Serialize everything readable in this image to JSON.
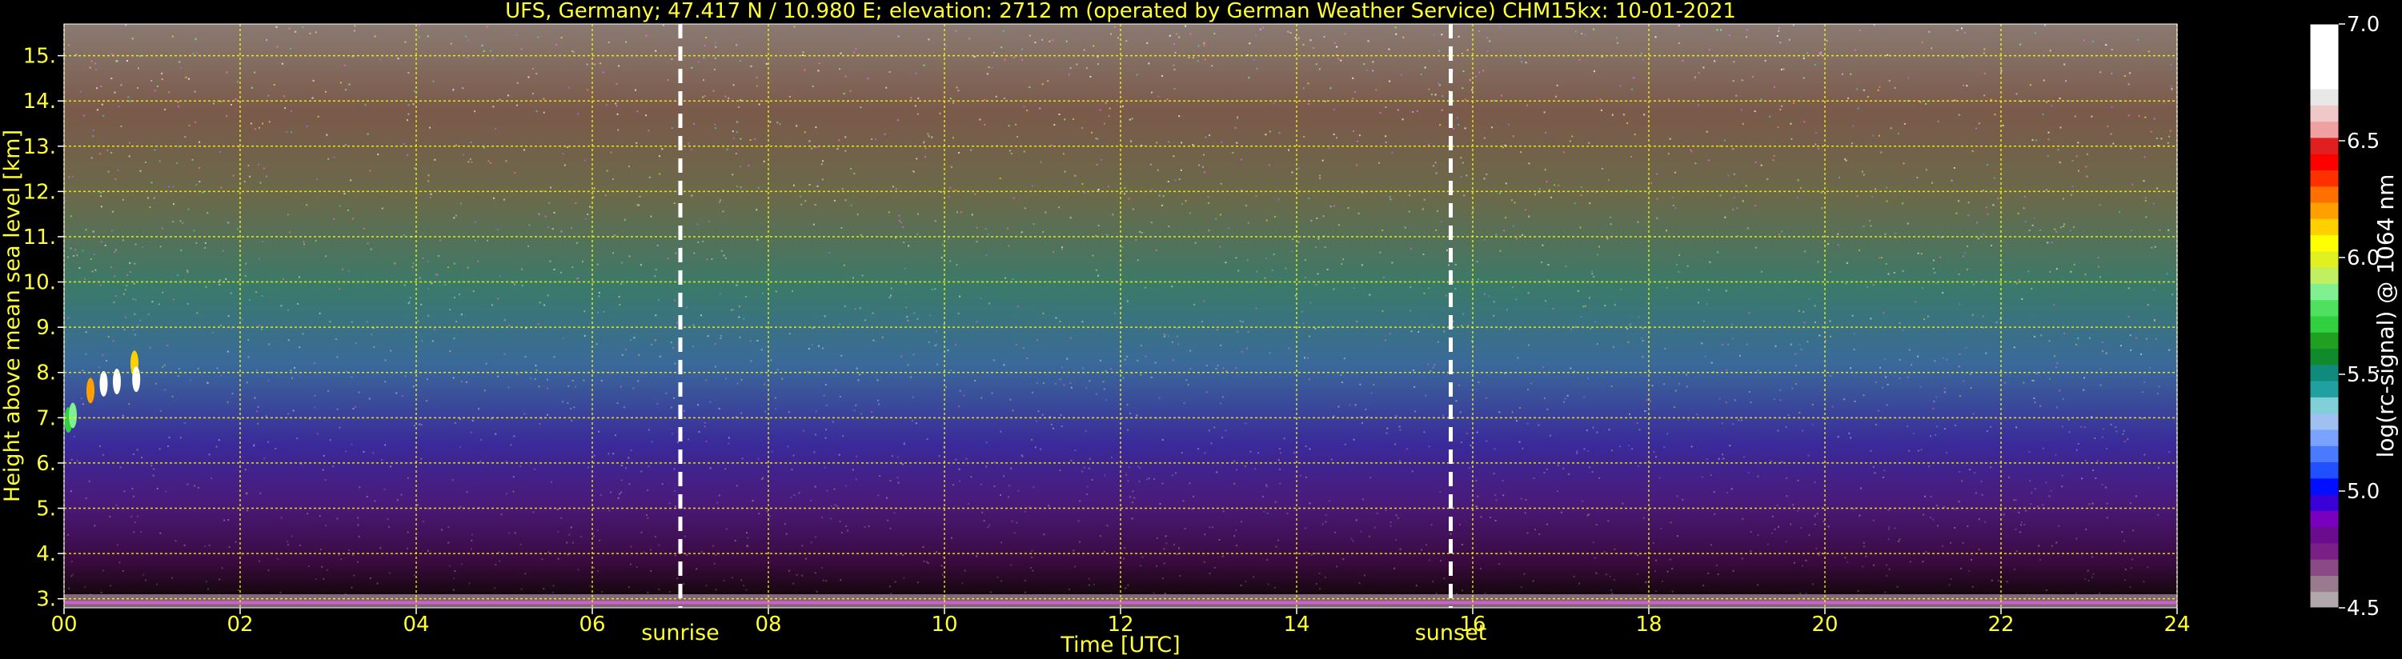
{
  "chart_data": {
    "type": "heatmap",
    "title": "UFS, Germany; 47.417 N / 10.980 E; elevation: 2712 m  (operated by German Weather Service)    CHM15kx: 10-01-2021",
    "xlabel": "Time [UTC]",
    "ylabel": "Height above mean sea level [km]",
    "xlim": [
      0,
      24
    ],
    "ylim": [
      2.8,
      15.7
    ],
    "x_ticks": [
      0,
      2,
      4,
      6,
      8,
      10,
      12,
      14,
      16,
      18,
      20,
      22,
      24
    ],
    "x_tick_labels": [
      "00",
      "02",
      "04",
      "06",
      "08",
      "10",
      "12",
      "14",
      "16",
      "18",
      "20",
      "22",
      "24"
    ],
    "y_ticks": [
      3,
      4,
      5,
      6,
      7,
      8,
      9,
      10,
      11,
      12,
      13,
      14,
      15
    ],
    "y_tick_labels": [
      "3.",
      "4.",
      "5.",
      "6.",
      "7.",
      "8.",
      "9.",
      "10.",
      "11.",
      "12.",
      "13.",
      "14.",
      "15."
    ],
    "grid": true,
    "grid_color": "#ffff00",
    "events": [
      {
        "label": "sunrise",
        "time": 7.0
      },
      {
        "label": "sunset",
        "time": 15.75
      }
    ],
    "colorbar": {
      "label": "log(rc-signal) @ 1064 nm",
      "range": [
        4.5,
        7.0
      ],
      "ticks": [
        4.5,
        5.0,
        5.5,
        6.0,
        6.5,
        7.0
      ],
      "tick_labels": [
        "4.5",
        "5.0",
        "5.5",
        "6.0",
        "6.5",
        "7.0"
      ],
      "colors": [
        "#b0a8ac",
        "#9a7a8e",
        "#8a4a86",
        "#7a1f86",
        "#6a0c8e",
        "#7a00c0",
        "#3a00d8",
        "#0010ff",
        "#2050ff",
        "#4a7aff",
        "#7aa2ff",
        "#a0c0f0",
        "#80d0d8",
        "#20a0a0",
        "#108a7a",
        "#108a2a",
        "#20a020",
        "#30d040",
        "#50e060",
        "#80f090",
        "#c0f060",
        "#e0f020",
        "#ffff00",
        "#ffd000",
        "#ffa000",
        "#ff7000",
        "#ff3000",
        "#ff0000",
        "#e02020",
        "#f0a0a0",
        "#f0c8c8",
        "#e8e8e8",
        "#ffffff",
        "#ffffff",
        "#ffffff",
        "#ffffff"
      ]
    },
    "features": [
      {
        "name": "cirrus cloud fragments",
        "time_range": [
          0.0,
          0.9
        ],
        "height_range": [
          6.8,
          8.5
        ]
      },
      {
        "name": "surface signal band",
        "time_range": [
          0,
          24
        ],
        "height_range": [
          2.8,
          3.1
        ]
      }
    ]
  }
}
